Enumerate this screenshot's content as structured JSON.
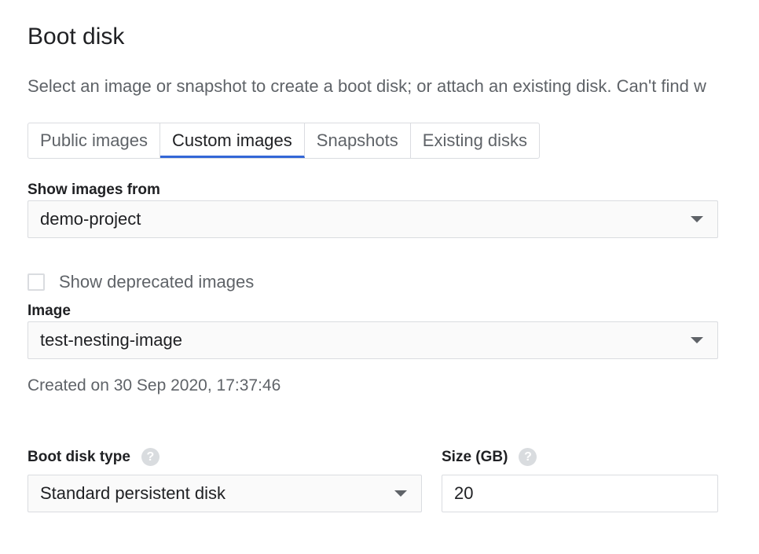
{
  "header": {
    "title": "Boot disk",
    "description": "Select an image or snapshot to create a boot disk; or attach an existing disk. Can't find w"
  },
  "tabs": [
    {
      "label": "Public images",
      "active": false
    },
    {
      "label": "Custom images",
      "active": true
    },
    {
      "label": "Snapshots",
      "active": false
    },
    {
      "label": "Existing disks",
      "active": false
    }
  ],
  "show_images_from": {
    "label": "Show images from",
    "value": "demo-project"
  },
  "deprecated": {
    "label": "Show deprecated images",
    "checked": false
  },
  "image": {
    "label": "Image",
    "value": "test-nesting-image",
    "created": "Created on 30 Sep 2020, 17:37:46"
  },
  "boot_disk_type": {
    "label": "Boot disk type",
    "help_icon": "help-icon",
    "value": "Standard persistent disk"
  },
  "size": {
    "label": "Size (GB)",
    "help_icon": "help-icon",
    "value": "20"
  },
  "colors": {
    "active_tab_underline": "#3367d6",
    "border": "#dadce0",
    "muted_text": "#5f6368"
  }
}
